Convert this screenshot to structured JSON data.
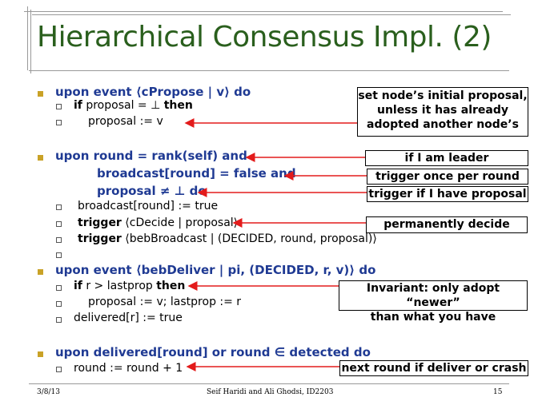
{
  "slide": {
    "title": "Hierarchical Consensus Impl. (2)",
    "lines": {
      "l1": "upon event ⟨cPropose | v⟩ do",
      "l1a_kw": "if",
      "l1a_mid": " proposal = ⊥ ",
      "l1a_kw2": "then",
      "l1b": "proposal := v",
      "l2a": "upon  round = rank(self) and",
      "l2b": "broadcast[round] = false and",
      "l2c": "proposal ≠ ⊥ do",
      "l2d": "broadcast[round] := true",
      "l2e_kw": "trigger",
      "l2e_rest": " ⟨cDecide | proposal⟩",
      "l2f_kw": "trigger",
      "l2f_rest": " ⟨bebBroadcast | (DECIDED, round, proposal)⟩",
      "l3": "upon event ⟨bebDeliver | pi, (DECIDED, r, v)⟩ do",
      "l3a_kw": "if",
      "l3a_mid": " r > lastprop ",
      "l3a_kw2": "then",
      "l3b": "proposal := v; lastprop := r",
      "l3c": "delivered[r] := true",
      "l4": "upon delivered[round] or round ∈ detected do",
      "l4a": "round := round + 1"
    },
    "notes": {
      "n1_l1": "set node’s initial proposal,",
      "n1_l2": "unless it has already",
      "n1_l3": "adopted another node’s",
      "n2": "if I am leader",
      "n3": "trigger once per round",
      "n4": "trigger if I have proposal",
      "n5": "permanently decide",
      "n6_l1": "Invariant: only adopt “newer”",
      "n6_l2": "than what you have",
      "n7": "next round if deliver or crash"
    },
    "footer": {
      "date": "3/8/13",
      "authors": "Seif Haridi and Ali Ghodsi, ID2203",
      "page": "15"
    },
    "colors": {
      "title": "#2a5f1d",
      "keyword_blue": "#1f3a93",
      "bullet": "#c9a227",
      "arrow": "#e31b1b"
    }
  }
}
